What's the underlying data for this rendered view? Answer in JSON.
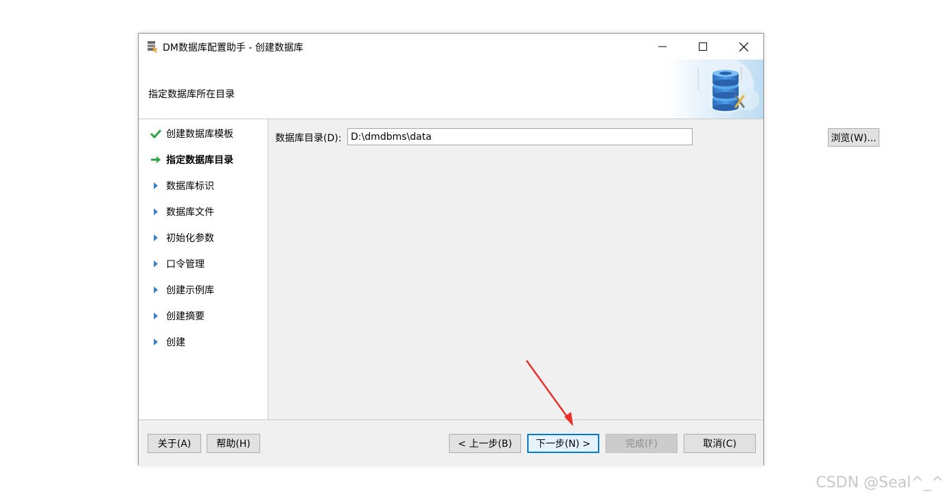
{
  "window": {
    "title": "DM数据库配置助手 - 创建数据库",
    "header_title": "指定数据库所在目录"
  },
  "steps": [
    {
      "label": "创建数据库模板",
      "state": "done"
    },
    {
      "label": "指定数据库目录",
      "state": "current"
    },
    {
      "label": "数据库标识",
      "state": "pending"
    },
    {
      "label": "数据库文件",
      "state": "pending"
    },
    {
      "label": "初始化参数",
      "state": "pending"
    },
    {
      "label": "口令管理",
      "state": "pending"
    },
    {
      "label": "创建示例库",
      "state": "pending"
    },
    {
      "label": "创建摘要",
      "state": "pending"
    },
    {
      "label": "创建",
      "state": "pending"
    }
  ],
  "form": {
    "dir_label": "数据库目录(D):",
    "dir_value": "D:\\dmdbms\\data",
    "browse_label": "浏览(W)..."
  },
  "footer": {
    "about_label": "关于(A)",
    "help_label": "帮助(H)",
    "prev_label": "< 上一步(B)",
    "next_label": "下一步(N) >",
    "finish_label": "完成(F)",
    "cancel_label": "取消(C)"
  },
  "watermark": "CSDN @Seal^_^",
  "colors": {
    "check": "#2ea043",
    "current_arrow": "#2ea043",
    "pending_triangle": "#3c7fc7",
    "annotation_arrow": "#e8302a"
  }
}
